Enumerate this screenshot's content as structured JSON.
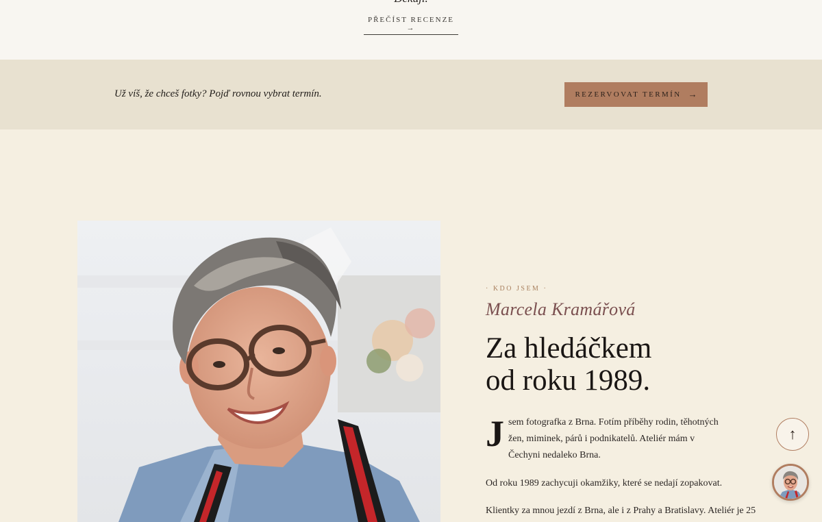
{
  "reviews": {
    "thanks_text": "Děkuji.",
    "read_reviews_label": "PŘEČÍST RECENZE →"
  },
  "cta": {
    "text": "Už víš, že chceš fotky? Pojď rovnou vybrat termín.",
    "button_label": "REZERVOVAT TERMÍN",
    "button_arrow": "→"
  },
  "about": {
    "eyebrow": "· KDO JSEM ·",
    "name": "Marcela Kramářová",
    "headline_line1": "Za hledáčkem",
    "headline_line2": "od roku 1989.",
    "dropcap": "J",
    "paragraph1": "sem fotografka z Brna. Fotím příběhy rodin, těhotných žen, miminek, párů i podnikatelů. Ateliér mám v Čechyni nedaleko Brna.",
    "paragraph2": "Od roku 1989 zachycuji okamžiky, které se nedají zopakovat.",
    "paragraph3": "Klientky za mnou jezdí z Brna, ale i z Prahy a Bratislavy. Ateliér je 25"
  },
  "floating": {
    "scroll_top_icon": "↑"
  },
  "colors": {
    "page_bg": "#f5efe1",
    "top_strip_bg": "#f8f6f1",
    "cta_band_bg": "#e8e1d0",
    "accent": "#b07d60",
    "name_color": "#7a4f4f"
  }
}
